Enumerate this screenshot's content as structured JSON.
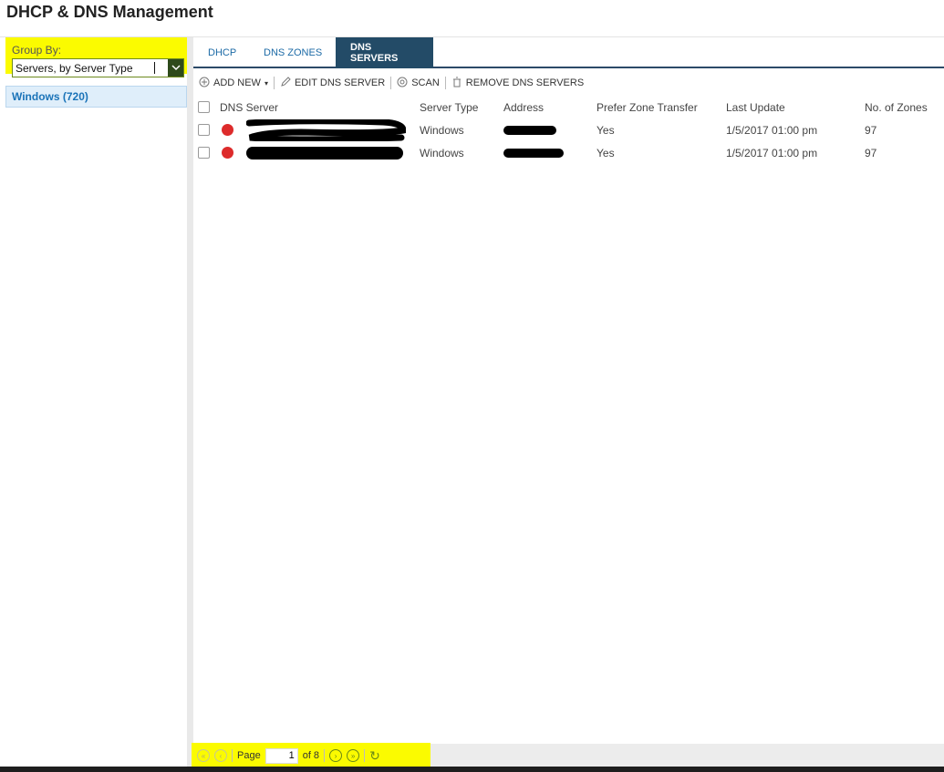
{
  "page": {
    "title": "DHCP & DNS Management"
  },
  "left": {
    "group_by_label": "Group By:",
    "group_by_value": "Servers, by Server Type",
    "tree_items": [
      {
        "label": "Windows (720)"
      }
    ]
  },
  "tabs": [
    {
      "label": "DHCP",
      "active": false
    },
    {
      "label": "DNS ZONES",
      "active": false
    },
    {
      "label": "DNS SERVERS",
      "active": true
    }
  ],
  "toolbar": {
    "add_new": "ADD NEW",
    "edit": "EDIT DNS SERVER",
    "scan": "SCAN",
    "remove": "REMOVE DNS SERVERS"
  },
  "grid": {
    "columns": [
      "DNS Server",
      "Server Type",
      "Address",
      "Prefer Zone Transfer",
      "Last Update",
      "No. of Zones"
    ],
    "rows": [
      {
        "status": "down",
        "server_type": "Windows",
        "prefer_zone_transfer": "Yes",
        "last_update": "1/5/2017 01:00 pm",
        "zones": "97"
      },
      {
        "status": "down",
        "server_type": "Windows",
        "prefer_zone_transfer": "Yes",
        "last_update": "1/5/2017 01:00 pm",
        "zones": "97"
      }
    ]
  },
  "pager": {
    "page_label": "Page",
    "page_value": "1",
    "of_label": "of 8"
  },
  "colors": {
    "status_down": "#dd2b2b",
    "active_tab": "#234b67",
    "highlight": "#fbfb00",
    "link": "#1a73b8"
  }
}
